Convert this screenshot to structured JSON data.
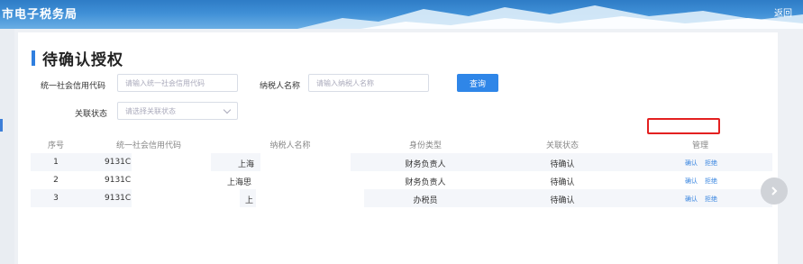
{
  "header": {
    "title": "市电子税务局",
    "back_label": "返回"
  },
  "page": {
    "title": "待确认授权"
  },
  "search": {
    "credit_code_label": "统一社会信用代码",
    "credit_code_placeholder": "请输入统一社会信用代码",
    "taxpayer_name_label": "纳税人名称",
    "taxpayer_name_placeholder": "请输入纳税人名称",
    "query_button": "查询",
    "status_label": "关联状态",
    "status_placeholder": "请选择关联状态"
  },
  "table": {
    "headers": [
      "序号",
      "统一社会信用代码",
      "纳税人名称",
      "身份类型",
      "关联状态",
      "管理"
    ],
    "rows": [
      {
        "index": "1",
        "code": "9131C",
        "name": "上海",
        "role": "财务负责人",
        "status": "待确认",
        "confirm": "确认",
        "reject": "拒绝"
      },
      {
        "index": "2",
        "code": "9131C",
        "name": "上海思",
        "role": "财务负责人",
        "status": "待确认",
        "confirm": "确认",
        "reject": "拒绝"
      },
      {
        "index": "3",
        "code": "9131C",
        "name": "上",
        "role": "办税员",
        "status": "待确认",
        "confirm": "确认",
        "reject": "拒绝"
      }
    ]
  },
  "colors": {
    "accent": "#2f86e8",
    "highlight": "#e32020"
  },
  "icons": {
    "next": "chevron-right-icon"
  }
}
